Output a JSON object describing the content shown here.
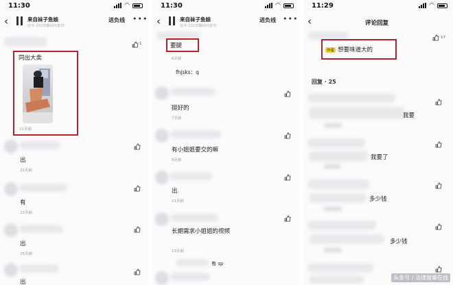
{
  "panel_left": {
    "status_time": "11:30",
    "header": {
      "title": "来自袜子鱼娘",
      "subtitle": "在今·202日期间内容日",
      "follow_label": "进负线",
      "more_label": "•••"
    },
    "comment_1": {
      "text": "同出大卖",
      "time": "21天前",
      "like_count": "1"
    },
    "comment_2": {
      "text": "出",
      "time": "21天前"
    },
    "comment_3": {
      "text": "有",
      "time": "23天前"
    },
    "comment_4": {
      "text": "出",
      "time": "25天前"
    },
    "comment_5": {
      "text": "出",
      "time": ""
    }
  },
  "panel_middle": {
    "status_time": "11:30",
    "header": {
      "title": "来自袜子鱼娘",
      "subtitle": "在今·202日期间内容日",
      "follow_label": "进负线",
      "more_label": "•••"
    },
    "comment_1": {
      "text": "要腿",
      "time": "6天前"
    },
    "comment_2": {
      "text": "fhjsks：q",
      "time": ""
    },
    "comment_3": {
      "text": "挺好的",
      "time": "7天前"
    },
    "comment_4": {
      "text": "有小姐姐要交的嘛",
      "time": "9天前"
    },
    "comment_5": {
      "text": "出",
      "time": "11天前"
    },
    "comment_6": {
      "text": "长期需求小姐姐的视频",
      "time": "13天前"
    },
    "comment_7": {
      "text": "有 sp",
      "time": ""
    }
  },
  "panel_right": {
    "status_time": "11:29",
    "header": {
      "title": "评论回复"
    },
    "top_comment": {
      "tag": "作者",
      "text": "想要味道大的",
      "like_count": "17"
    },
    "replies_label": "回复 · 25",
    "replies": [
      "我要",
      "我要了",
      "多少钱",
      "多少钱"
    ]
  },
  "watermark": "头条号 / 法律故事在线"
}
